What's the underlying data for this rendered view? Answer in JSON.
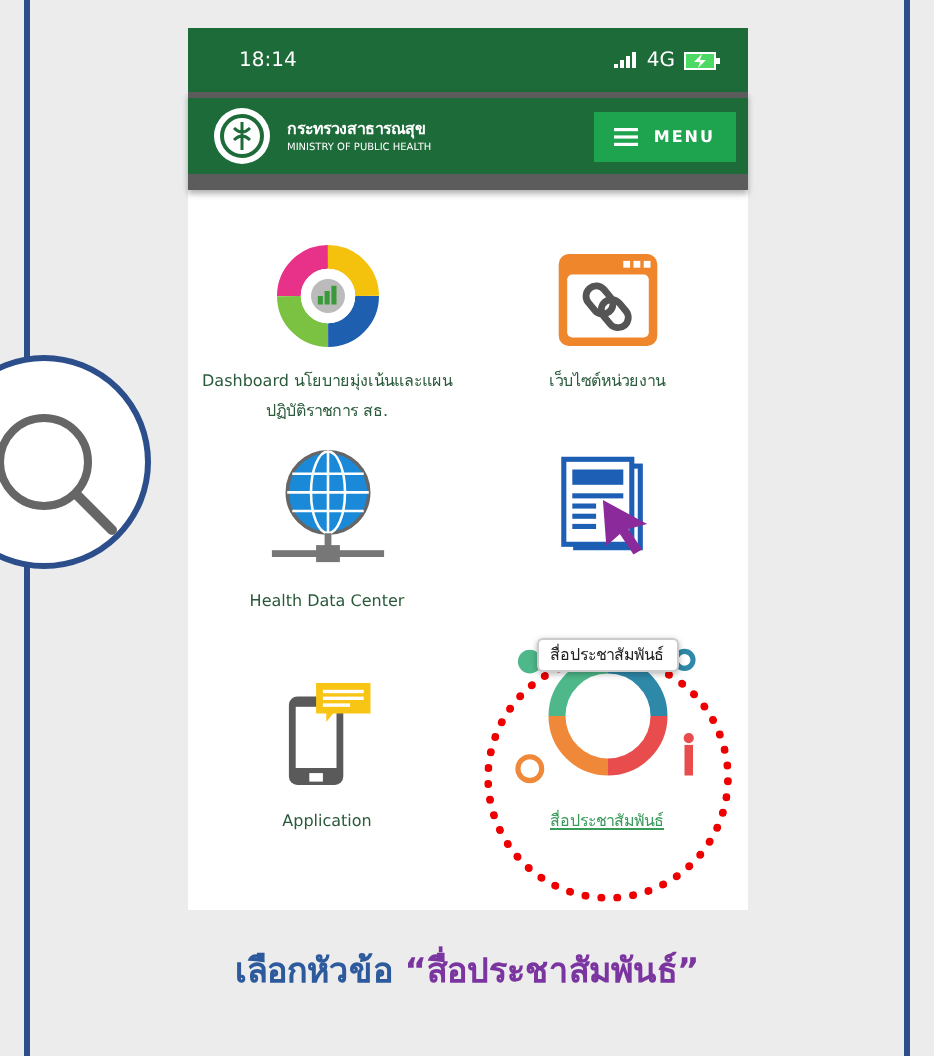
{
  "status_bar": {
    "time": "18:14",
    "network": "4G"
  },
  "header": {
    "org_name_th": "กระทรวงสาธารณสุข",
    "org_name_en": "MINISTRY OF PUBLIC HEALTH",
    "menu_button": "MENU"
  },
  "tiles": [
    {
      "kind": "dashboard",
      "label": "Dashboard นโยบายมุ่งเน้นและแผนปฏิบัติราชการ สธ."
    },
    {
      "kind": "website",
      "label": "เว็บไซต์หน่วยงาน"
    },
    {
      "kind": "data-center",
      "label": "Health Data Center"
    },
    {
      "kind": "news"
    },
    {
      "kind": "application",
      "label": "Application"
    },
    {
      "kind": "media",
      "label": "สื่อประชาสัมพันธ์",
      "link": true,
      "highlighted": true
    }
  ],
  "tooltip": "สื่อประชาสัมพันธ์",
  "caption": {
    "text": "เลือกหัวข้อ",
    "quoted": "“สื่อประชาสัมพันธ์”"
  }
}
